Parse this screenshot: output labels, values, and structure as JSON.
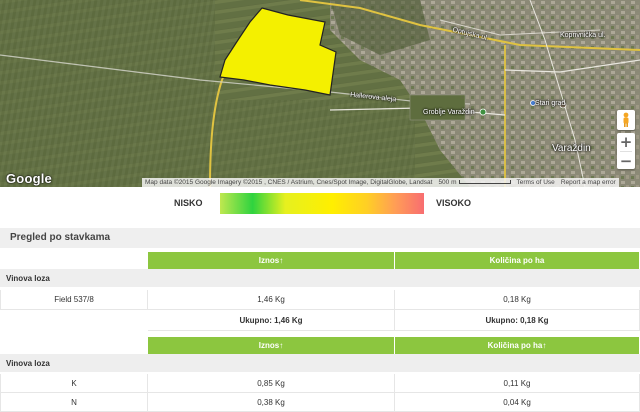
{
  "map": {
    "google_logo": "Google",
    "attribution": "Map data ©2015 Google Imagery ©2015 , CNES / Astrium, Cnes/Spot Image, DigitalGlobe, Landsat",
    "scale_label": "500 m",
    "terms_label": "Terms of Use",
    "report_label": "Report a map error",
    "zoom_in": "+",
    "zoom_out": "−",
    "field_color": "#f4f000",
    "labels": {
      "optujska": "Optujska ul.",
      "koprivnicka": "Koprivnička ul.",
      "hallerova": "Hallerova aleja",
      "groblje": "Groblje Varaždin",
      "stari_grad": "Stari grad",
      "city": "Varaždin"
    }
  },
  "legend": {
    "low": "NISKO",
    "high": "VISOKO"
  },
  "section": {
    "title": "Pregled po stavkama"
  },
  "table1": {
    "headers": [
      "",
      "Iznos↑",
      "Količina po ha"
    ],
    "group": "Vinova loza",
    "rows": [
      {
        "name": "Field 537/8",
        "amount": "1,46 Kg",
        "per_ha": "0,18 Kg"
      }
    ],
    "total": {
      "amount": "Ukupno: 1,46 Kg",
      "per_ha": "Ukupno: 0,18 Kg"
    }
  },
  "table2": {
    "headers": [
      "",
      "Iznos↑",
      "Količina po ha↑"
    ],
    "group": "Vinova loza",
    "rows": [
      {
        "name": "K",
        "amount": "0,85 Kg",
        "per_ha": "0,11 Kg"
      },
      {
        "name": "N",
        "amount": "0,38 Kg",
        "per_ha": "0,04 Kg"
      }
    ]
  },
  "colors": {
    "header_green": "#8cc63f",
    "group_gray": "#eeeeee"
  }
}
